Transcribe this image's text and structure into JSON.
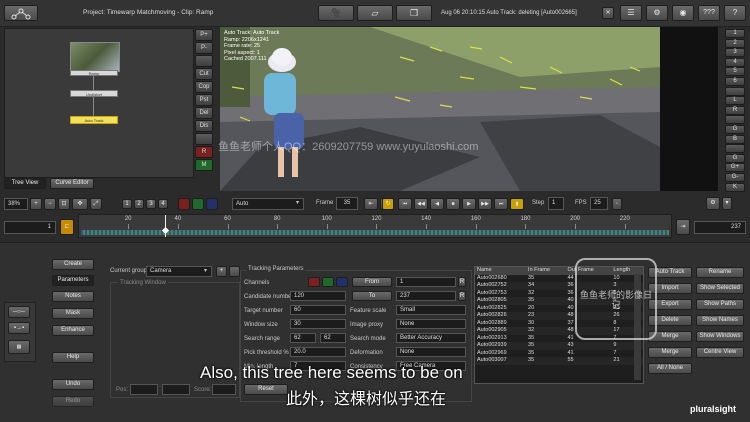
{
  "header": {
    "project_title": "Project: Timewarp Matchmoving - Clip: Ramp",
    "status_text": "Aug 06 20:10:15 Auto Track: deleting [Auto002665]",
    "help_label": "???",
    "icon_names": [
      "node-graph-icon",
      "camera-icon",
      "layers-icon",
      "clips-icon",
      "close-icon",
      "list-view-icon",
      "settings-icon",
      "camera-icon",
      "help-icon",
      "question-icon"
    ]
  },
  "node_graph": {
    "nodes": [
      "Ramp",
      "Undistort",
      "Auto Track"
    ],
    "side_buttons": [
      "P+",
      "P-",
      "",
      "Cut",
      "Cop",
      "Pst",
      "Del",
      "Dis",
      "",
      "R",
      "M"
    ],
    "tabs": [
      "Tree View",
      "Curve Editor"
    ]
  },
  "viewer": {
    "overlay_lines": [
      "Auto Track: Auto Track",
      "Ramp: 2206x1241",
      "Frame rate: 25",
      "Pixel aspect: 1",
      "Cached 2007.111"
    ],
    "right_buttons": [
      "1",
      "2",
      "3",
      "4",
      "5",
      "6",
      "",
      "L",
      "R",
      "",
      "G",
      "B",
      "",
      "G",
      "G+",
      "G-",
      "K"
    ],
    "watermark": "鱼鱼老师个人QQ：2609207759  www.yuyulaoshi.com"
  },
  "transport": {
    "zoom": "38%",
    "channel_numbers": [
      "1",
      "2",
      "3",
      "4"
    ],
    "display_mode": "Auto",
    "frame_label": "Frame",
    "frame_value": "35",
    "step_label": "Step",
    "step_value": "1",
    "fps_label": "FPS",
    "fps_value": "25"
  },
  "timeline": {
    "start_frame": "1",
    "end_frame": "237",
    "ticks": [
      "20",
      "40",
      "60",
      "80",
      "100",
      "120",
      "140",
      "160",
      "180",
      "200",
      "220"
    ],
    "current_frame": 35,
    "range": [
      1,
      237
    ]
  },
  "left_tools": {
    "buttons": [
      "Create",
      "Parameters",
      "Notes",
      "Mask",
      "Enhance",
      "Help",
      "Undo",
      "Redo"
    ],
    "current_group_label": "Current group",
    "current_group_value": "Camera",
    "tracking_window_label": "Tracking Window",
    "pos_label": "Pos:",
    "score_label": "Score:"
  },
  "tracking_params": {
    "title": "Tracking Parameters",
    "channels_label": "Channels",
    "from_label": "From",
    "from_value": "1",
    "to_label": "To",
    "to_value": "237",
    "candidate_label": "Candidate number",
    "candidate_value": "120",
    "target_label": "Target number",
    "target_value": "60",
    "window_label": "Window size",
    "window_value": "30",
    "search_label": "Search range",
    "search_value_a": "62",
    "search_value_b": "62",
    "thresh_label": "Pick threshold %",
    "thresh_value": "20.0",
    "minlen_label": "Min. length",
    "minlen_value": "7",
    "feature_label": "Feature scale",
    "feature_value": "Small",
    "proxy_label": "Image proxy",
    "proxy_value": "None",
    "mode_label": "Search mode",
    "mode_value": "Better Accuracy",
    "deform_label": "Deformation",
    "deform_value": "None",
    "consistency_label": "Consistency",
    "consistency_value": "Free Camera",
    "reset_label": "Reset"
  },
  "tracker_list": {
    "columns": [
      "Name",
      "In Frame",
      "Out Frame",
      "Length"
    ],
    "rows": [
      [
        "Auto002680",
        "35",
        "44",
        "10"
      ],
      [
        "Auto002752",
        "34",
        "36",
        "3"
      ],
      [
        "Auto002753",
        "32",
        "36",
        "5"
      ],
      [
        "Auto002805",
        "35",
        "40",
        "6"
      ],
      [
        "Auto002825",
        "20",
        "40",
        "21"
      ],
      [
        "Auto002826",
        "23",
        "48",
        "26"
      ],
      [
        "Auto002889",
        "30",
        "37",
        "8"
      ],
      [
        "Auto002905",
        "32",
        "48",
        "17"
      ],
      [
        "Auto002913",
        "35",
        "41",
        "7"
      ],
      [
        "Auto002939",
        "35",
        "43",
        "9"
      ],
      [
        "Auto002969",
        "35",
        "41",
        "7"
      ],
      [
        "Auto003007",
        "35",
        "55",
        "21"
      ]
    ],
    "buttons_left": [
      "Auto Track",
      "Import",
      "Export",
      "Delete",
      "Merge",
      "Merge",
      "All / None"
    ],
    "buttons_right": [
      "Rename",
      "Show Selected",
      "Show Paths",
      "Show Names",
      "Show Windows",
      "Centre View"
    ]
  },
  "subtitles": {
    "english": "Also, this tree here seems to be on",
    "chinese": "此外，这棵树似乎还在"
  },
  "branding": {
    "pluralsight": "pluralsight",
    "stamp_text": "鱼鱼老师的影像日记"
  }
}
